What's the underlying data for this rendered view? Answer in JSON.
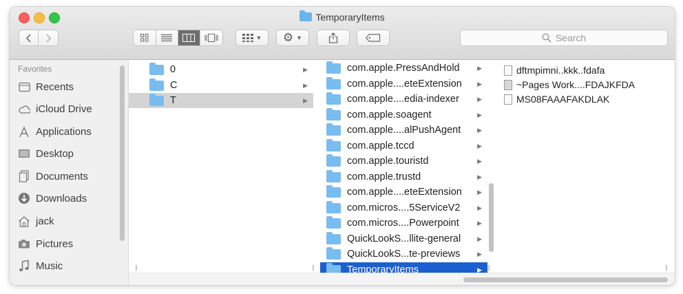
{
  "window": {
    "title": "TemporaryItems"
  },
  "toolbar": {
    "back_icon": "chevron-left",
    "forward_icon": "chevron-right",
    "view_modes": [
      "icon-view",
      "list-view",
      "column-view",
      "cover-flow-view"
    ],
    "active_view": "column-view",
    "search_placeholder": "Search"
  },
  "sidebar": {
    "heading": "Favorites",
    "items": [
      {
        "label": "Recents",
        "icon": "recents-icon"
      },
      {
        "label": "iCloud Drive",
        "icon": "cloud-icon"
      },
      {
        "label": "Applications",
        "icon": "applications-icon"
      },
      {
        "label": "Desktop",
        "icon": "desktop-icon"
      },
      {
        "label": "Documents",
        "icon": "documents-icon"
      },
      {
        "label": "Downloads",
        "icon": "downloads-icon"
      },
      {
        "label": "jack",
        "icon": "home-icon"
      },
      {
        "label": "Pictures",
        "icon": "pictures-icon"
      },
      {
        "label": "Music",
        "icon": "music-icon"
      }
    ]
  },
  "column1": {
    "items": [
      {
        "label": "0"
      },
      {
        "label": "C"
      },
      {
        "label": "T",
        "selected": true
      }
    ]
  },
  "column2": {
    "items": [
      {
        "label": "com.apple.PressAndHold"
      },
      {
        "label": "com.apple....eteExtension"
      },
      {
        "label": "com.apple....edia-indexer"
      },
      {
        "label": "com.apple.soagent"
      },
      {
        "label": "com.apple....alPushAgent"
      },
      {
        "label": "com.apple.tccd"
      },
      {
        "label": "com.apple.touristd"
      },
      {
        "label": "com.apple.trustd"
      },
      {
        "label": "com.apple....eteExtension"
      },
      {
        "label": "com.micros....5ServiceV2"
      },
      {
        "label": "com.micros....Powerpoint"
      },
      {
        "label": "QuickLookS...llite-general"
      },
      {
        "label": "QuickLookS...te-previews"
      },
      {
        "label": "TemporaryItems",
        "selected": true
      }
    ]
  },
  "column3": {
    "items": [
      {
        "label": "dftmpimni..kkk..fdafa",
        "icon": "document-icon"
      },
      {
        "label": "~Pages Work....FDAJKFDA",
        "icon": "pages-document-icon"
      },
      {
        "label": "MS08FAAAFAKDLAK",
        "icon": "document-icon"
      }
    ]
  },
  "colors": {
    "selection_blue": "#1c5fcf",
    "selection_gray": "#d4d4d4",
    "folder_blue": "#79bcf0"
  }
}
